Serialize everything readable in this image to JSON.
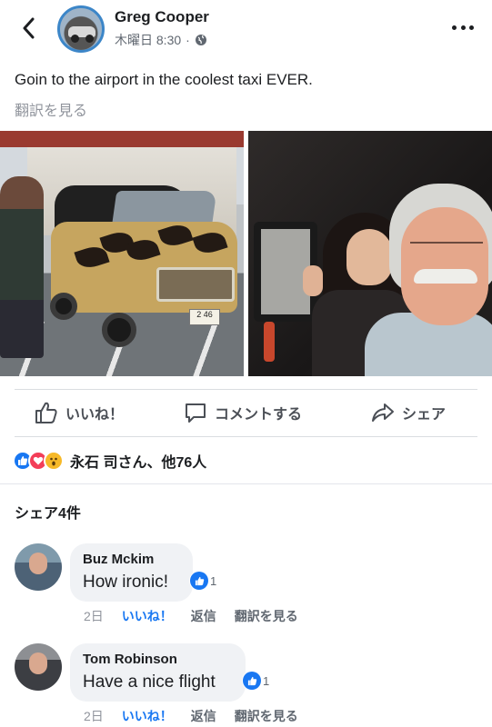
{
  "header": {
    "author": "Greg Cooper",
    "timestamp": "木曜日 8:30",
    "separator": "·",
    "privacy_icon": "globe-icon",
    "back_icon": "chevron-left-icon",
    "more_icon": "more-horizontal-icon"
  },
  "post": {
    "text": "Goin to the airport in the coolest taxi EVER.",
    "see_translation": "翻訳を見る"
  },
  "photos": [
    {
      "icon": "van-photo",
      "plate": "2 46"
    },
    {
      "icon": "selfie-photo"
    }
  ],
  "actions": {
    "like": "いいね！",
    "comment": "コメントする",
    "share": "シェア"
  },
  "reactions": {
    "summary": "永石 司さん、他76人",
    "types": [
      "like",
      "love",
      "wow"
    ]
  },
  "shares": "シェア4件",
  "comments": [
    {
      "name": "Buz Mckim",
      "text": "How ironic!",
      "likes": "1",
      "time": "2日",
      "like_label": "いいね！",
      "reply_label": "返信",
      "translate_label": "翻訳を見る"
    },
    {
      "name": "Tom Robinson",
      "text": "Have a nice flight",
      "likes": "1",
      "time": "2日",
      "like_label": "いいね！",
      "reply_label": "返信",
      "translate_label": "翻訳を見る"
    }
  ],
  "colors": {
    "accent": "#1877f2",
    "text": "#1c1e21",
    "secondary": "#606770",
    "love": "#f33e58",
    "wow": "#f7b928"
  }
}
